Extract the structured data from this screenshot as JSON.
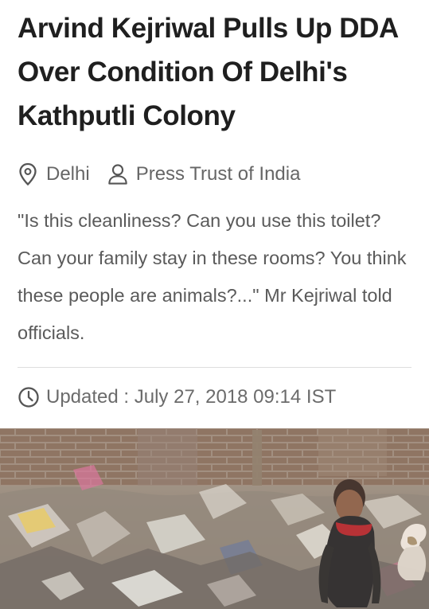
{
  "article": {
    "headline": "Arvind Kejriwal Pulls Up DDA Over Condition Of Delhi's Kathputli Colony",
    "location": "Delhi",
    "location_icon": "location-pin-icon",
    "source": "Press Trust of India",
    "source_icon": "person-icon",
    "summary": "\"Is this cleanliness? Can you use this toilet? Can your family stay in these rooms? You think these people are animals?...\" Mr Kejriwal told officials.",
    "updated": "Updated : July 27, 2018 09:14 IST",
    "updated_icon": "clock-icon"
  },
  "colors": {
    "headline": "#1f1f1f",
    "meta_text": "#666666",
    "summary_text": "#5a5a5a",
    "divider": "#dddddd"
  }
}
